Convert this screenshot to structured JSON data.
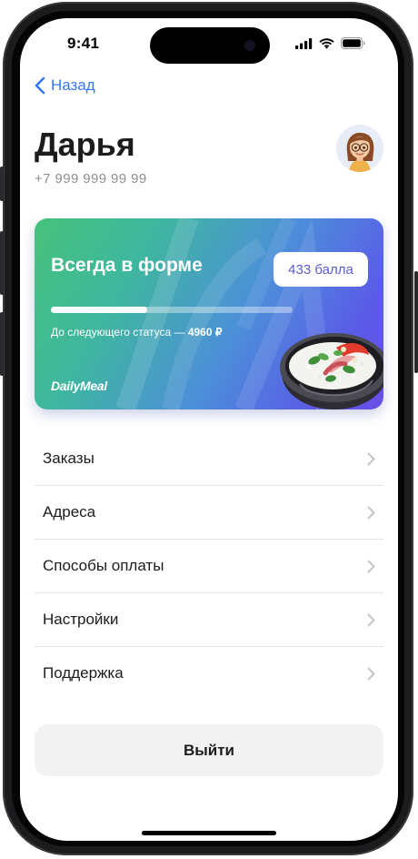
{
  "status_bar": {
    "time": "9:41"
  },
  "nav": {
    "back_label": "Назад"
  },
  "profile": {
    "name": "Дарья",
    "phone": "+7 999 999 99 99"
  },
  "loyalty_card": {
    "title": "Всегда в форме",
    "points": "433 балла",
    "progress_fraction": 0.4,
    "next_status_prefix": "До следующего статуса — ",
    "next_status_amount": "4960 ₽",
    "brand": "DailyMeal"
  },
  "menu": {
    "items": [
      {
        "label": "Заказы"
      },
      {
        "label": "Адреса"
      },
      {
        "label": "Способы оплаты"
      },
      {
        "label": "Настройки"
      },
      {
        "label": "Поддержка"
      }
    ]
  },
  "logout_label": "Выйти",
  "colors": {
    "accent": "#3478F6",
    "points_text": "#5B5AD6",
    "card_gradient_start": "#46C27A",
    "card_gradient_end": "#6A4FE6"
  }
}
